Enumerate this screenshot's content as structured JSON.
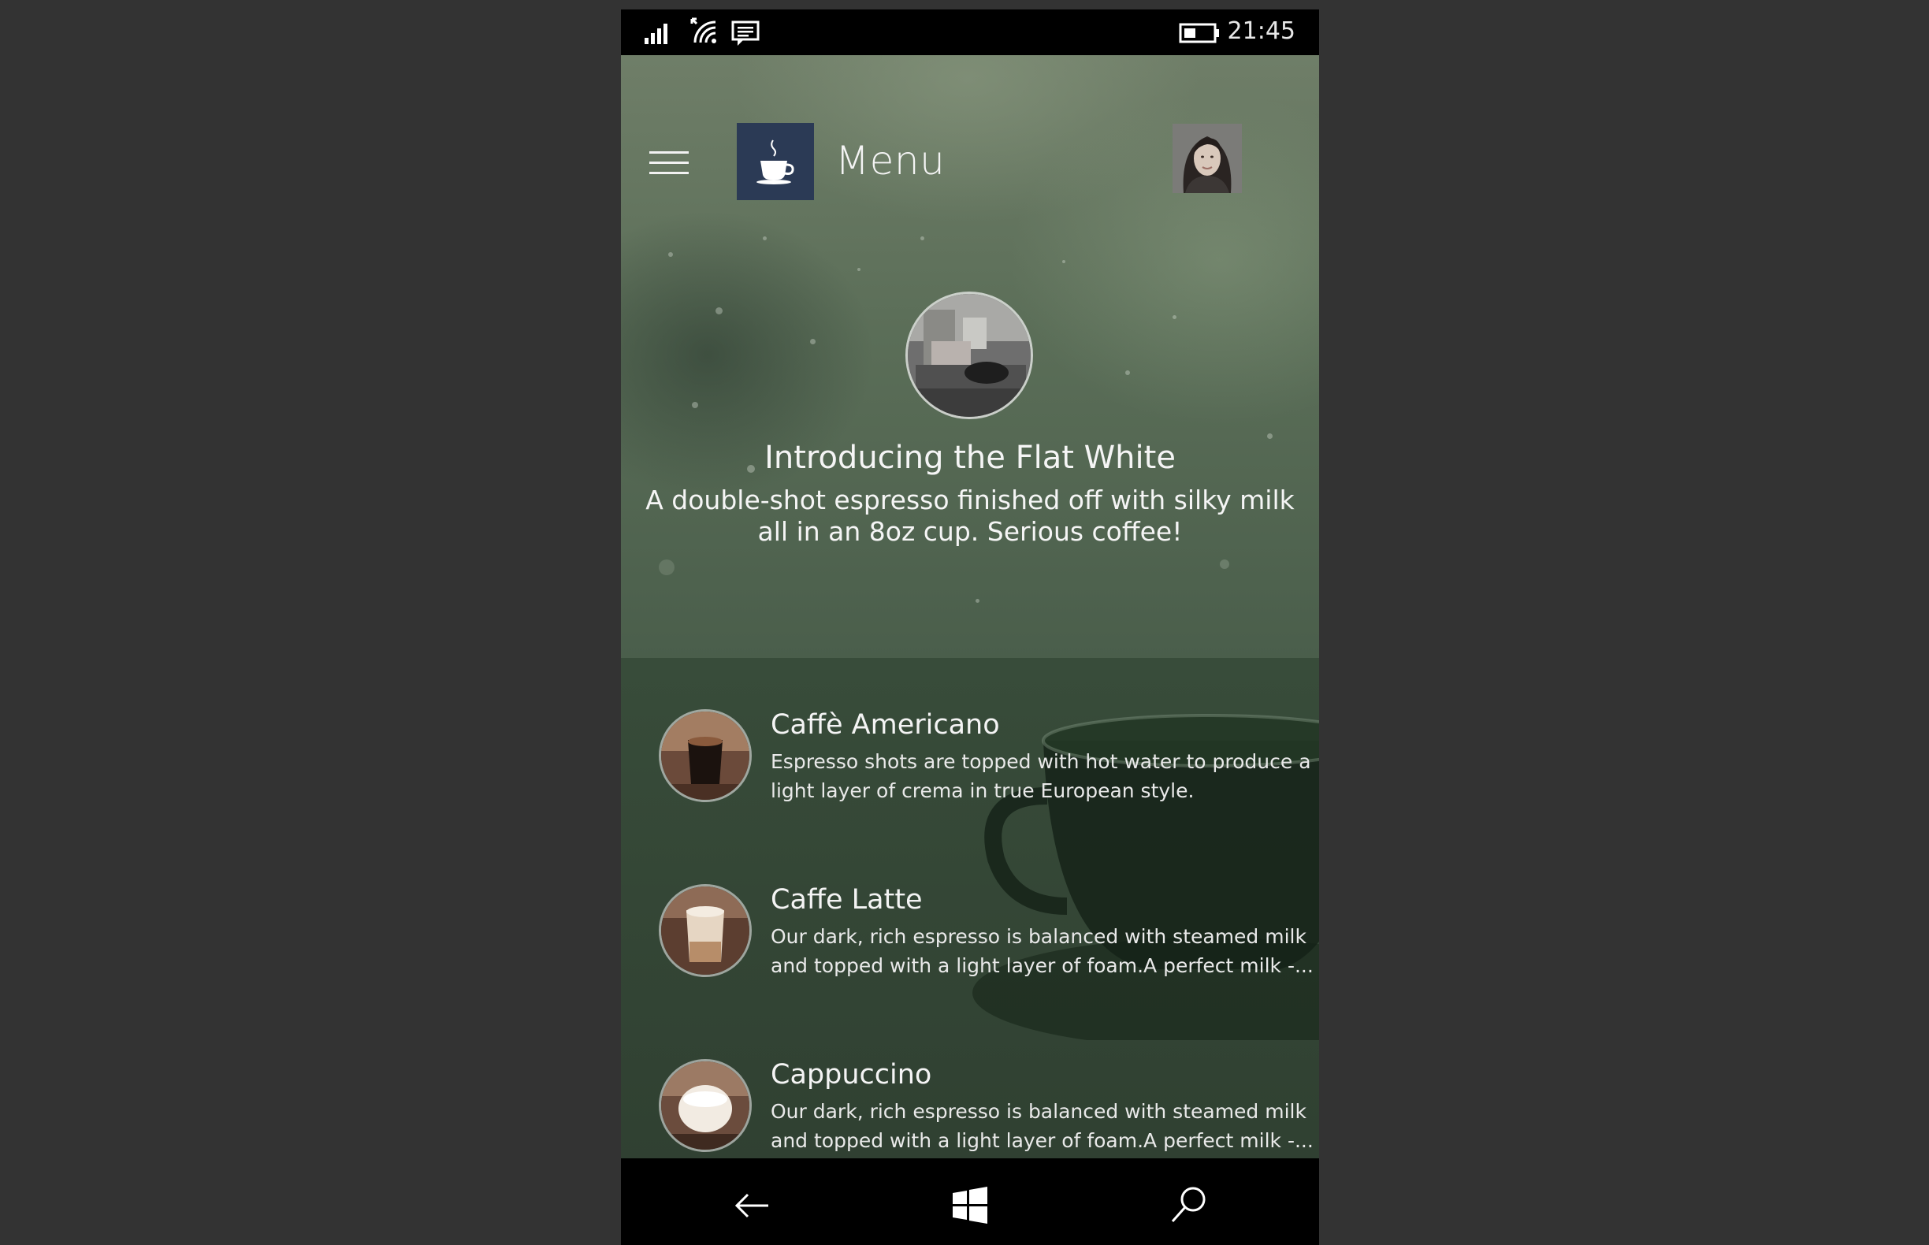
{
  "status_bar": {
    "time": "21:45",
    "icons": [
      "signal-icon",
      "wifi-icon",
      "message-icon",
      "battery-icon"
    ]
  },
  "header": {
    "title": "Menu",
    "menu_icon": "hamburger-icon",
    "logo_icon": "coffee-cup-icon"
  },
  "feature": {
    "title": "Introducing the Flat White",
    "description": "A double-shot espresso finished off with silky milk all in an 8oz cup. Serious coffee!"
  },
  "items": [
    {
      "name": "Caffè Americano",
      "description": "Espresso shots are topped with hot water to produce a light layer of crema in true European style."
    },
    {
      "name": "Caffe Latte",
      "description": "Our dark, rich espresso is balanced with steamed milk and topped with a light layer of foam.A perfect milk -..."
    },
    {
      "name": "Cappuccino",
      "description": "Our dark, rich espresso is balanced with steamed milk and topped with a light layer of foam.A perfect milk -..."
    }
  ],
  "nav_bar": {
    "icons": [
      "back-arrow-icon",
      "windows-start-icon",
      "search-icon"
    ]
  },
  "colors": {
    "background": "#333333",
    "logo_tile": "#2b3a55",
    "screen_green": "#4a5e4b"
  }
}
